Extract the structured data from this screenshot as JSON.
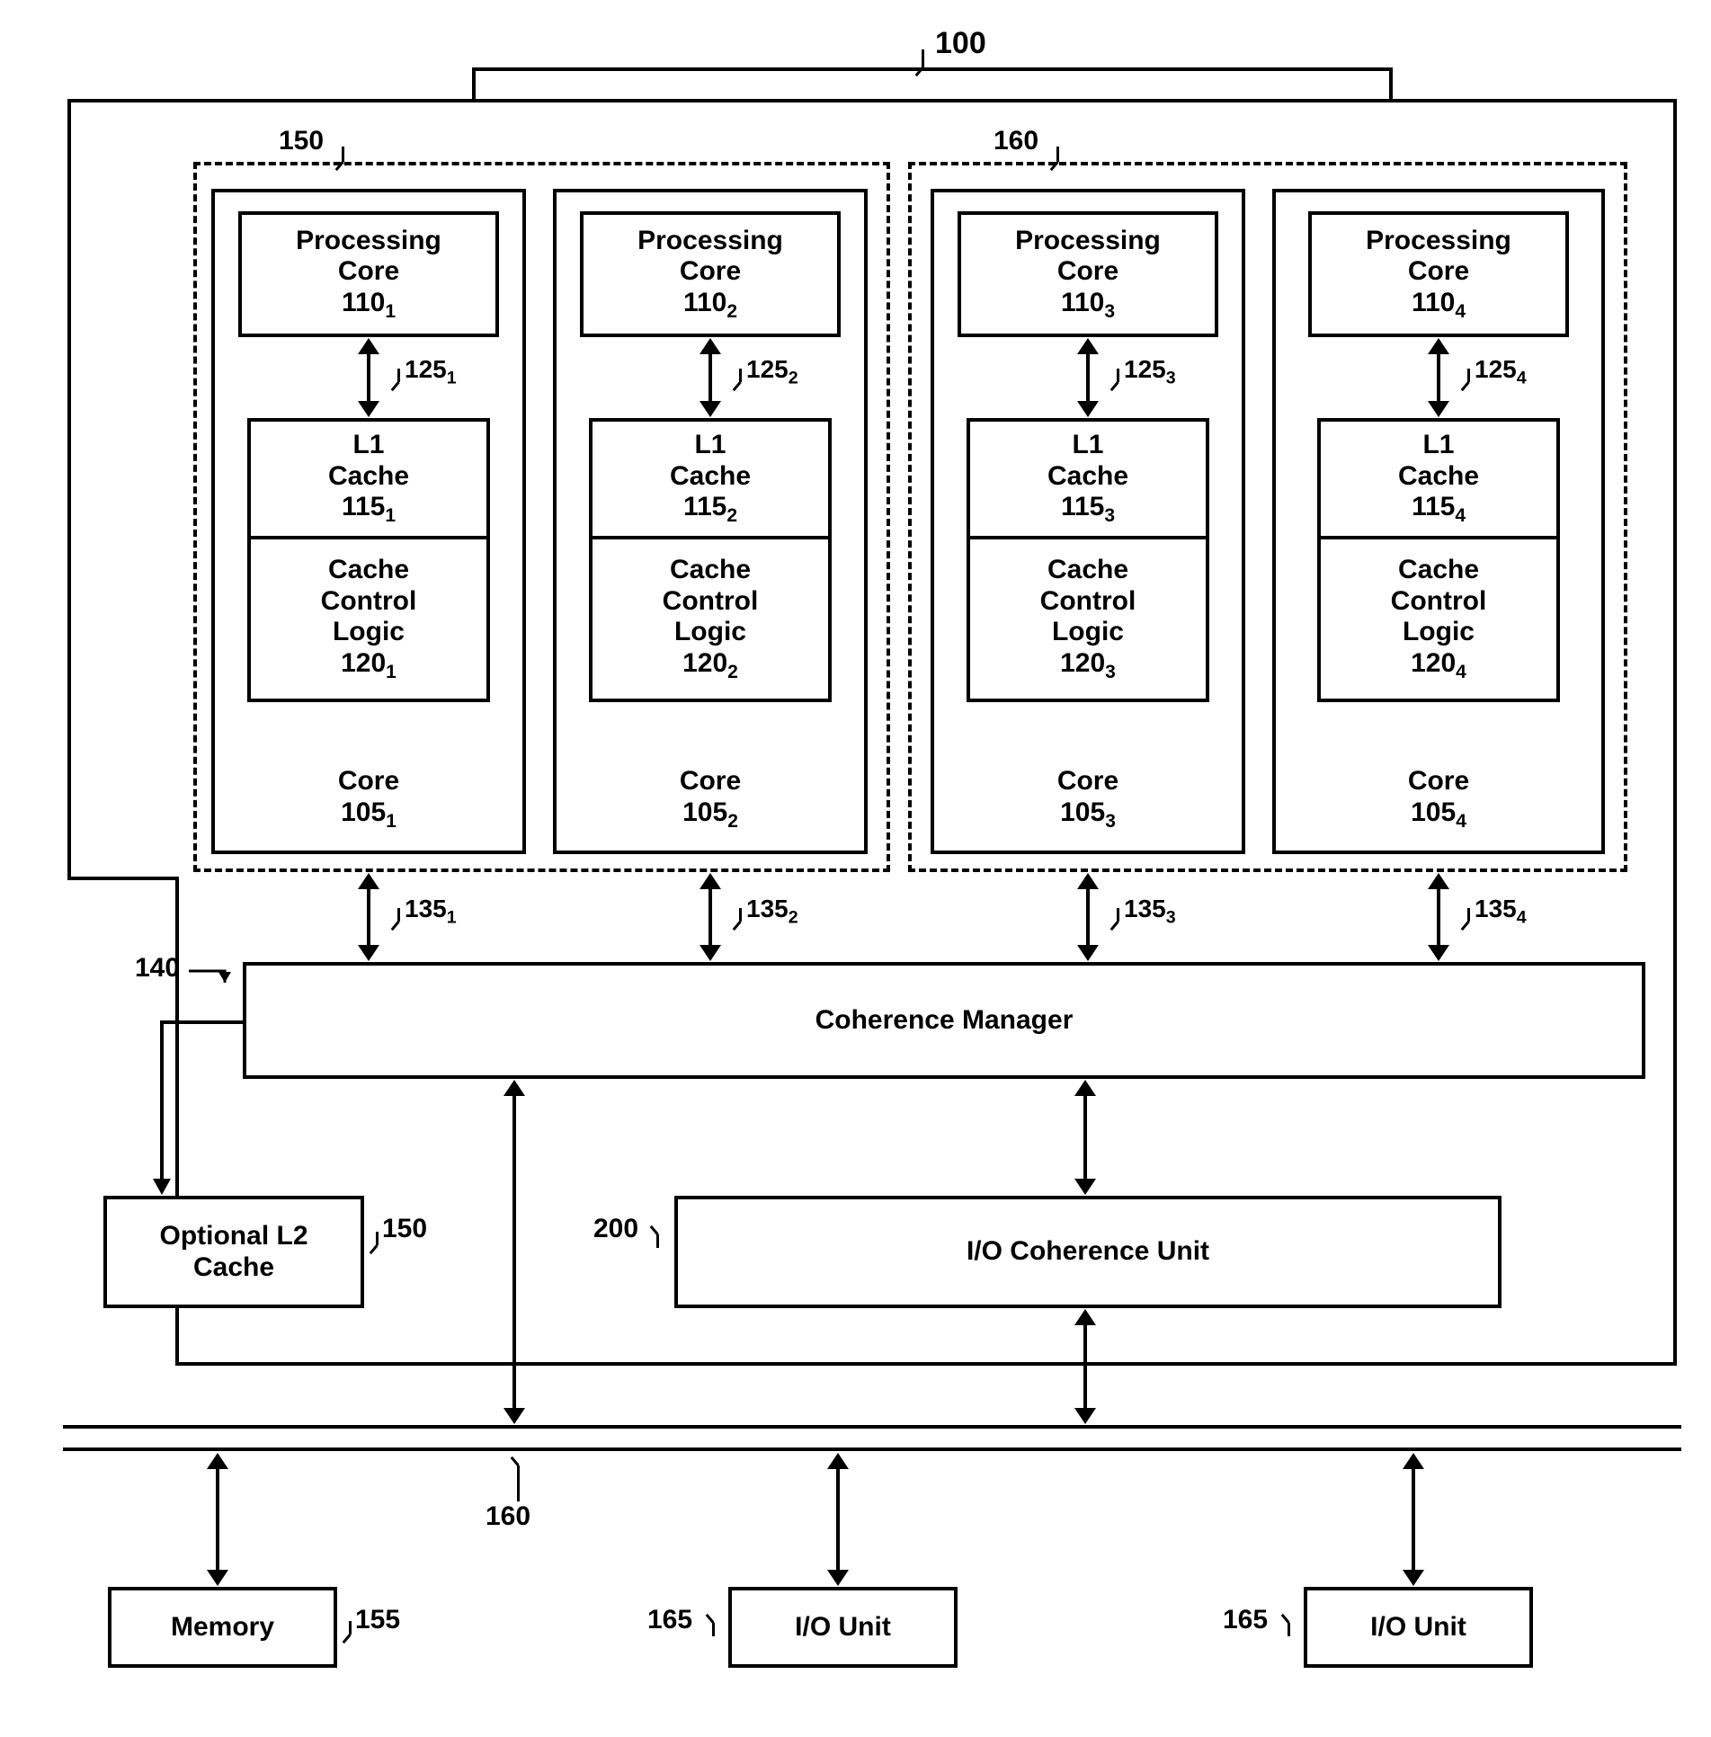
{
  "refs": {
    "system": "100",
    "cluster1": "150",
    "cluster2": "160",
    "coherence": "140",
    "l2ref": "150",
    "iocohref": "200",
    "busref": "160",
    "memref": "155",
    "iounitref1": "165",
    "iounitref2": "165",
    "c125_1": "125",
    "c125_2": "125",
    "c125_3": "125",
    "c125_4": "125",
    "c135_1": "135",
    "c135_2": "135",
    "c135_3": "135",
    "c135_4": "135"
  },
  "labels": {
    "processing_core": "Processing\nCore",
    "l1_cache": "L1\nCache",
    "cache_control_logic": "Cache\nControl\nLogic",
    "core": "Core",
    "coherence_manager": "Coherence Manager",
    "optional_l2": "Optional L2\nCache",
    "io_coherence": "I/O Coherence Unit",
    "memory": "Memory",
    "io_unit": "I/O Unit"
  },
  "nums": {
    "pc_base": "110",
    "l1_base": "115",
    "ccl_base": "120",
    "core_base": "105"
  }
}
